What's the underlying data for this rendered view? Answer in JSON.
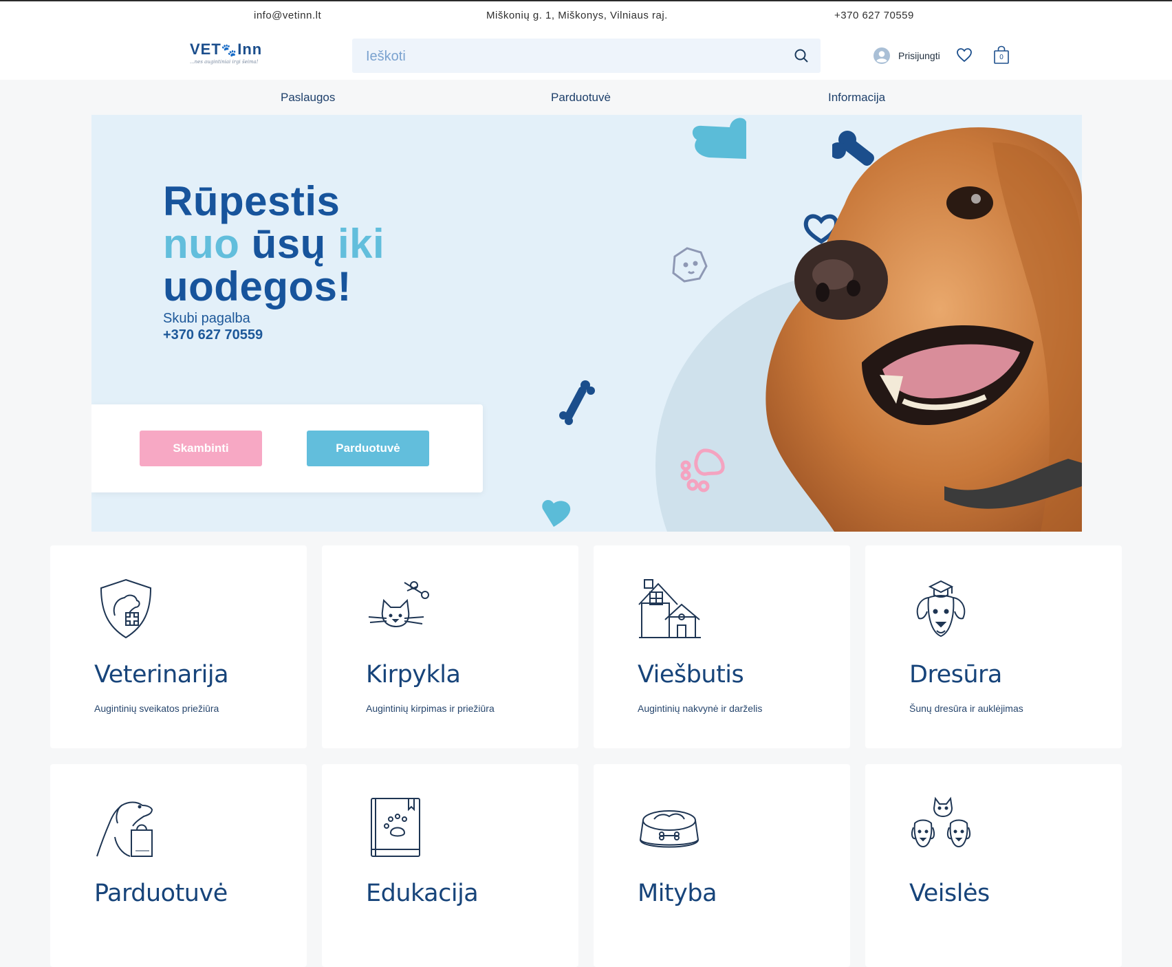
{
  "colors": {
    "brand_dark": "#17549c",
    "brand_light": "#62bedc",
    "cta_pink": "#f7a8c4",
    "hero_bg": "#e3f0f9"
  },
  "topbar": {
    "email": "info@vetinn.lt",
    "address": "Miškonių g. 1, Miškonys, Vilniaus raj.",
    "phone": "+370 627 70559"
  },
  "logo": {
    "title_left": "VET",
    "title_right": "Inn",
    "subtitle": "...nes augintiniai irgi šeima!"
  },
  "search": {
    "placeholder": "Ieškoti",
    "icon": "search-icon"
  },
  "account": {
    "login_label": "Prisijungti",
    "cart_count": "0"
  },
  "nav": [
    "Paslaugos",
    "Parduotuvė",
    "Informacija"
  ],
  "hero": {
    "line1": "Rūpestis",
    "line2_a": "nuo",
    "line2_b": "ūsų",
    "line2_c": "iki",
    "line3": "uodegos!",
    "emergency_label": "Skubi pagalba",
    "emergency_phone": "+370 627 70559",
    "btn_call": "Skambinti",
    "btn_shop": "Parduotuvė"
  },
  "cards": [
    {
      "title": "Veterinarija",
      "desc": "Augintinių sveikatos priežiūra",
      "icon": "vet-shield-icon"
    },
    {
      "title": "Kirpykla",
      "desc": "Augintinių kirpimas ir priežiūra",
      "icon": "cat-scissors-icon"
    },
    {
      "title": "Viešbutis",
      "desc": "Augintinių nakvynė ir darželis",
      "icon": "pet-hotel-icon"
    },
    {
      "title": "Dresūra",
      "desc": "Šunų dresūra ir auklėjimas",
      "icon": "dog-graduate-icon"
    },
    {
      "title": "Parduotuvė",
      "desc": "",
      "icon": "dog-shopping-bag-icon"
    },
    {
      "title": "Edukacija",
      "desc": "",
      "icon": "paw-book-icon"
    },
    {
      "title": "Mityba",
      "desc": "",
      "icon": "food-bowl-icon"
    },
    {
      "title": "Veislės",
      "desc": "",
      "icon": "dog-breeds-icon"
    }
  ]
}
